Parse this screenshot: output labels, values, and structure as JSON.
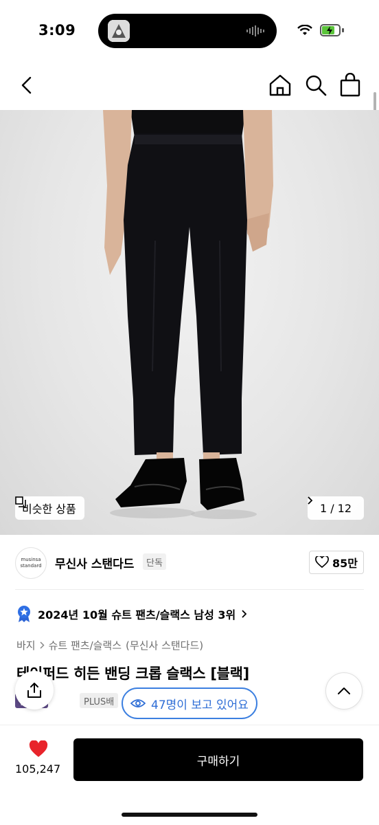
{
  "status_bar": {
    "time": "3:09"
  },
  "nav": {
    "icons": [
      "chevron-left-icon",
      "home-icon",
      "search-icon",
      "shopping-bag-icon"
    ]
  },
  "hero": {
    "similar_label": "비슷한 상품",
    "pager": "1 / 12"
  },
  "brand": {
    "logo_line1": "musinsa",
    "logo_line2": "standard",
    "name": "무신사 스탠다드",
    "badge": "단독",
    "likes": "85만"
  },
  "ranking": {
    "text": "2024년 10월 슈트 팬츠/슬랙스 남성 3위"
  },
  "breadcrumb": {
    "root": "바지",
    "category": "슈트 팬츠/슬랙스",
    "brand": "(무신사 스탠다드)"
  },
  "product": {
    "title": "테이퍼드 히든 밴딩 크롭 슬랙스 [블랙]",
    "tag_sale": "산세일",
    "tag_plus": "PLUS배"
  },
  "viewers": {
    "text": "47명이 보고 있어요"
  },
  "bottom_bar": {
    "like_count": "105,247",
    "buy_label": "구매하기"
  },
  "colors": {
    "accent_blue": "#3b7fe0",
    "heart_red": "#e8242b",
    "sale_purple": "#5d4a86"
  }
}
